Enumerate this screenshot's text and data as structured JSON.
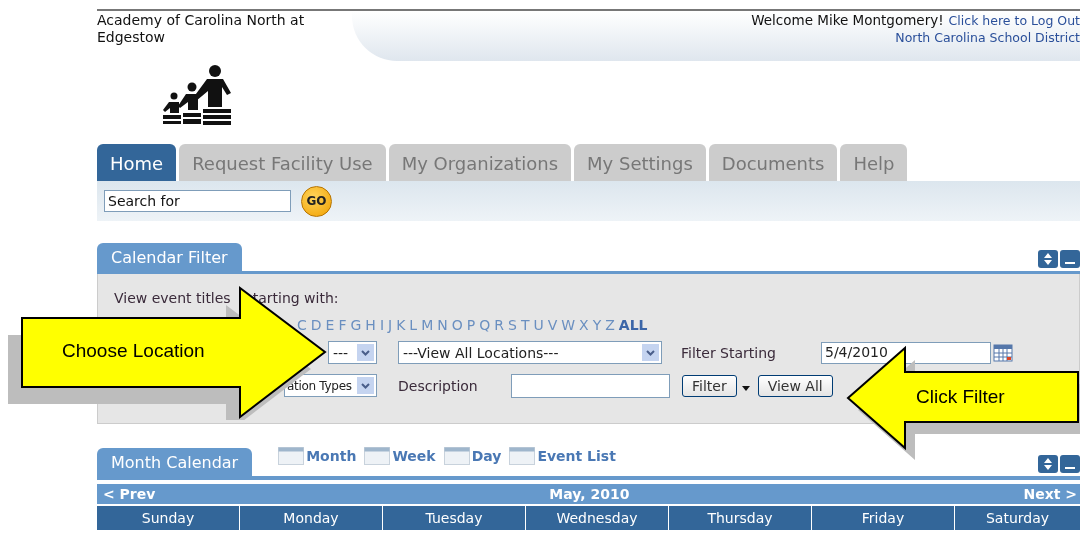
{
  "header": {
    "school_name": "Academy of Carolina North at Edgestow",
    "welcome": "Welcome Mike Montgomery!",
    "logout_link": "Click here to Log Out",
    "district": "North Carolina School District"
  },
  "tabs": [
    {
      "label": "Home",
      "selected": true
    },
    {
      "label": "Request Facility Use",
      "selected": false
    },
    {
      "label": "My Organizations",
      "selected": false
    },
    {
      "label": "My Settings",
      "selected": false
    },
    {
      "label": "Documents",
      "selected": false
    },
    {
      "label": "Help",
      "selected": false
    }
  ],
  "search": {
    "placeholder": "Search for",
    "go_button": "GO"
  },
  "calendar_filter": {
    "title": "Calendar Filter",
    "prompt_parts": [
      "View event titles",
      "tarting with:"
    ],
    "letters": [
      {
        "label": "C",
        "kind": "letter"
      },
      {
        "label": "D",
        "kind": "letter"
      },
      {
        "label": "E",
        "kind": "letter"
      },
      {
        "label": "F",
        "kind": "letter"
      },
      {
        "label": "G",
        "kind": "letter"
      },
      {
        "label": "H",
        "kind": "letter"
      },
      {
        "label": "I",
        "kind": "letter"
      },
      {
        "label": "J",
        "kind": "letter"
      },
      {
        "label": "K",
        "kind": "letter"
      },
      {
        "label": "L",
        "kind": "letter"
      },
      {
        "label": "M",
        "kind": "letter"
      },
      {
        "label": "N",
        "kind": "letter"
      },
      {
        "label": "O",
        "kind": "letter"
      },
      {
        "label": "P",
        "kind": "letter"
      },
      {
        "label": "Q",
        "kind": "letter"
      },
      {
        "label": "R",
        "kind": "letter"
      },
      {
        "label": "S",
        "kind": "letter"
      },
      {
        "label": "T",
        "kind": "letter"
      },
      {
        "label": "U",
        "kind": "letter"
      },
      {
        "label": "V",
        "kind": "letter"
      },
      {
        "label": "W",
        "kind": "letter"
      },
      {
        "label": "X",
        "kind": "letter"
      },
      {
        "label": "Y",
        "kind": "letter"
      },
      {
        "label": "Z",
        "kind": "letter"
      },
      {
        "label": "ALL",
        "kind": "all"
      }
    ],
    "organization_select": {
      "value": "---"
    },
    "location_select": {
      "value": "---View All Locations---"
    },
    "filter_starting": {
      "label": "Filter Starting",
      "value": "5/4/2010"
    },
    "type_select": {
      "value": "ation Types"
    },
    "description": {
      "label": "Description"
    },
    "buttons": [
      "Filter",
      "View All"
    ]
  },
  "callouts": [
    {
      "text": "Choose Location",
      "kind": "right"
    },
    {
      "text": "Click Filter",
      "kind": "left"
    }
  ],
  "month_calendar": {
    "title": "Month Calendar",
    "views": [
      "Month",
      "Week",
      "Day",
      "Event List"
    ],
    "nav": {
      "prev": "< Prev",
      "title": "May, 2010",
      "next": "Next >"
    },
    "days": [
      "Sunday",
      "Monday",
      "Tuesday",
      "Wednesday",
      "Thursday",
      "Friday",
      "Saturday"
    ]
  }
}
